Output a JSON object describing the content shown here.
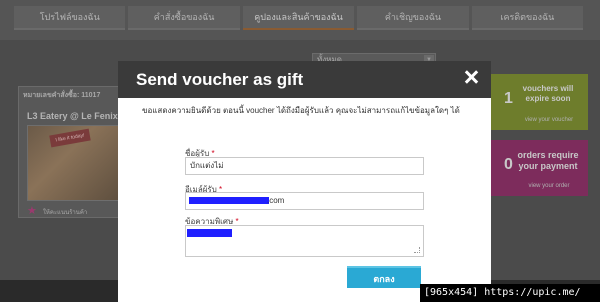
{
  "background": {
    "tabs": [
      "โปรไฟล์ของฉัน",
      "คำสั่งซื้อของฉัน",
      "คูปองและสินค้าของฉัน",
      "คำเชิญของฉัน",
      "เครดิตของฉัน"
    ],
    "filter_select": "ทั้งหมด",
    "card": {
      "order_label": "หมายเลขคำสั่งซื้อ: 11017",
      "title": "L3 Eatery @ Le Fenix",
      "food_tag": "I like it today!",
      "fav_label": "ให้คะแนนร้านค้า"
    },
    "vouchers_panel": {
      "count": "1",
      "text": "vouchers will expire soon",
      "link": "view your voucher"
    },
    "orders_panel": {
      "count": "0",
      "text": "orders require your payment",
      "link": "view your order"
    }
  },
  "modal": {
    "title": "Send voucher as gift",
    "intro": "ขอแสดงความยินดีด้วย ตอนนี้ voucher ได้ถึงมือผู้รับแล้ว คุณจะไม่สามารถแก้ไขข้อมูลใดๆ ได้",
    "name_label": "ชื่อผู้รับ",
    "name_value": "บักแต่งไม่",
    "email_label": "อีเมล์ผู้รับ",
    "email_suffix": ".com",
    "message_label": "ข้อความพิเศษ",
    "required_mark": "*",
    "ok_button": "ตกลง"
  },
  "watermark": "[965x454] https://upic.me/",
  "colors": {
    "modal_header": "#3a3a3a",
    "ok_button": "#2aa9d4",
    "required": "#d0021b",
    "vouchers_panel": "#6e7d2c",
    "orders_panel": "#7d2c5c"
  }
}
